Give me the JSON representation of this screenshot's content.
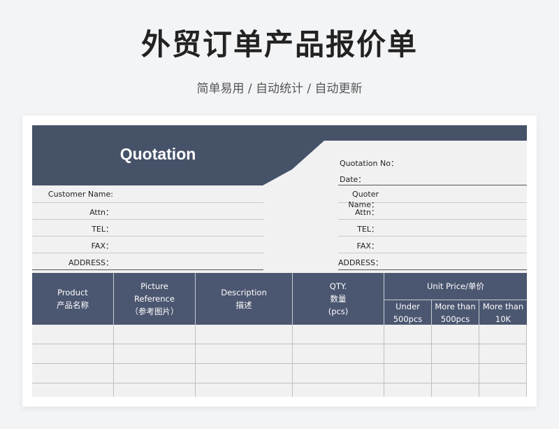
{
  "header": {
    "title": "外贸订单产品报价单",
    "subtitle": "简单易用 / 自动统计 / 自动更新"
  },
  "colors": {
    "banner": "#465268",
    "table_header": "#4b5670",
    "sheet_bg": "#f1f1f1"
  },
  "quotation": {
    "title": "Quotation",
    "quotation_no_label": "Quotation No：",
    "date_label": "Date："
  },
  "customer_fields": [
    {
      "label": "Customer Name:"
    },
    {
      "label": "Attn："
    },
    {
      "label": "TEL："
    },
    {
      "label": "FAX："
    },
    {
      "label": "ADDRESS："
    }
  ],
  "quoter_fields": [
    {
      "label": "Quoter Name："
    },
    {
      "label": "Attn："
    },
    {
      "label": "TEL："
    },
    {
      "label": "FAX："
    },
    {
      "label": "ADDRESS："
    }
  ],
  "table": {
    "columns": [
      {
        "line1": "Product",
        "line2": "产品名称",
        "line3": ""
      },
      {
        "line1": "Picture",
        "line2": "Reference",
        "line3": "（参考图片）"
      },
      {
        "line1": "Description",
        "line2": "描述",
        "line3": ""
      },
      {
        "line1": "QTY.",
        "line2": "数量",
        "line3": "(pcs)"
      }
    ],
    "unit_price": {
      "label": "Unit Price/单价",
      "tiers": [
        {
          "line1": "Under",
          "line2": "500pcs"
        },
        {
          "line1": "More than",
          "line2": "500pcs"
        },
        {
          "line1": "More than",
          "line2": "10K"
        }
      ]
    },
    "empty_rows": 4
  }
}
